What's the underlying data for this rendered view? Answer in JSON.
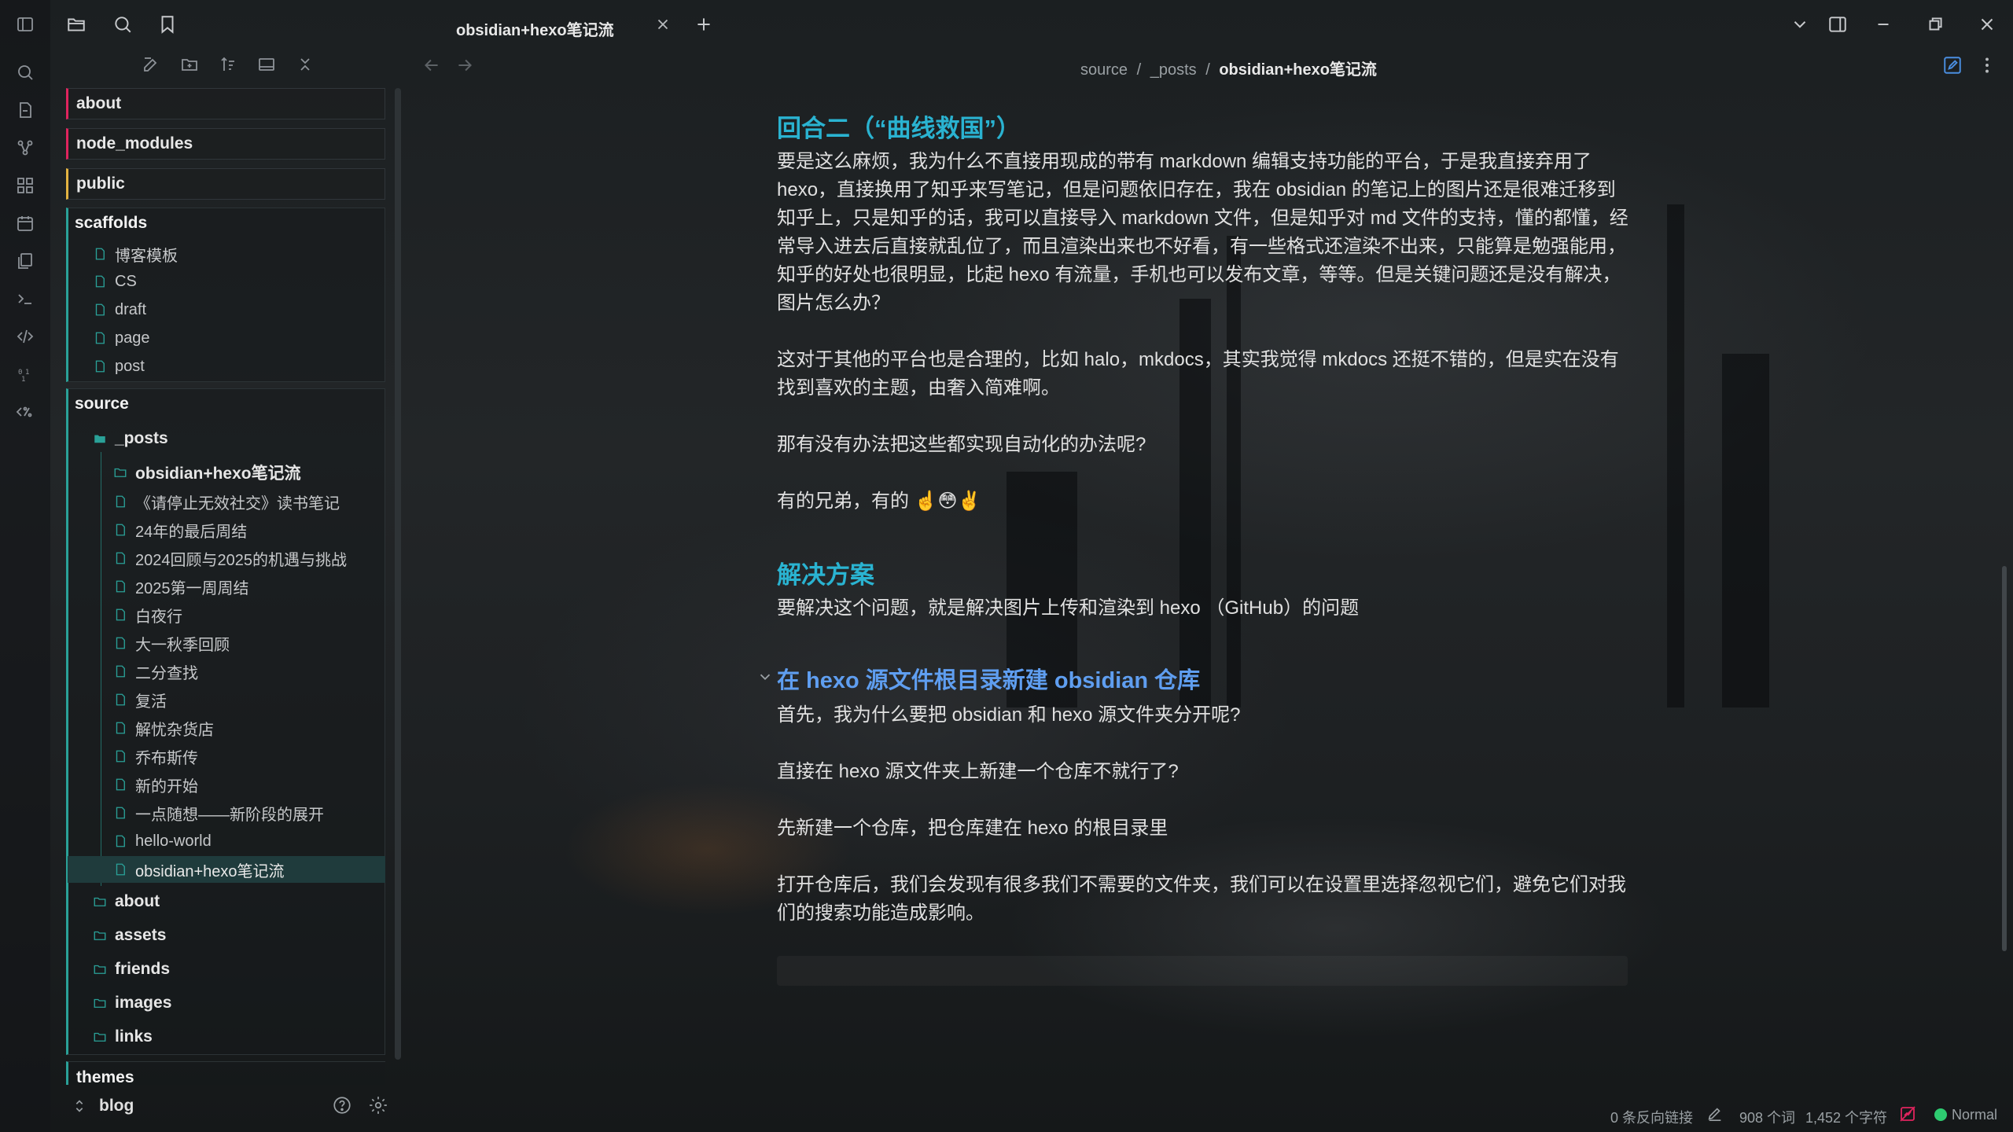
{
  "tab": {
    "title": "obsidian+hexo笔记流"
  },
  "breadcrumb": {
    "part1": "source",
    "sep": "/",
    "part2": "_posts",
    "current": "obsidian+hexo笔记流"
  },
  "explorer": {
    "top_folders": [
      {
        "label": "about",
        "color": "#e0245e"
      },
      {
        "label": "node_modules",
        "color": "#e0245e"
      },
      {
        "label": "public",
        "color": "#e3b341"
      }
    ],
    "scaffolds": {
      "label": "scaffolds",
      "files": [
        "博客模板",
        "CS",
        "draft",
        "page",
        "post"
      ]
    },
    "source": {
      "label": "source",
      "posts_folder": "_posts",
      "posts_subfolder": "obsidian+hexo笔记流",
      "files": [
        "《请停止无效社交》读书笔记",
        "24年的最后周结",
        "2024回顾与2025的机遇与挑战",
        "2025第一周周结",
        "白夜行",
        "大一秋季回顾",
        "二分查找",
        "复活",
        "解忧杂货店",
        "乔布斯传",
        "新的开始",
        "一点随想——新阶段的展开",
        "hello-world",
        "obsidian+hexo笔记流"
      ],
      "folders": [
        "about",
        "assets",
        "friends",
        "images",
        "links"
      ]
    },
    "themes": "themes",
    "vault_name": "blog"
  },
  "doc": {
    "h_round2": "回合二（“曲线救国”）",
    "p1": "要是这么麻烦，我为什么不直接用现成的带有 markdown 编辑支持功能的平台，于是我直接弃用了 hexo，直接换用了知乎来写笔记，但是问题依旧存在，我在 obsidian 的笔记上的图片还是很难迁移到知乎上，只是知乎的话，我可以直接导入 markdown 文件，但是知乎对 md 文件的支持，懂的都懂，经常导入进去后直接就乱位了，而且渲染出来也不好看，有一些格式还渲染不出来，只能算是勉强能用，知乎的好处也很明显，比起 hexo 有流量，手机也可以发布文章，等等。但是关键问题还是没有解决，图片怎么办？",
    "p2": "这对于其他的平台也是合理的，比如 halo，mkdocs，其实我觉得 mkdocs 还挺不错的，但是实在没有找到喜欢的主题，由奢入简难啊。",
    "p3": "那有没有办法把这些都实现自动化的办法呢?",
    "p4": "有的兄弟，有的 ☝️😳✌️",
    "h_solution": "解决方案",
    "p5": "要解决这个问题，就是解决图片上传和渲染到 hexo （GitHub）的问题",
    "h_vault": "在 hexo 源文件根目录新建 obsidian 仓库",
    "p6": "首先，我为什么要把 obsidian 和 hexo 源文件夹分开呢?",
    "p7": "直接在 hexo 源文件夹上新建一个仓库不就行了?",
    "p8": "先新建一个仓库，把仓库建在 hexo 的根目录里",
    "p9": "打开仓库后，我们会发现有很多我们不需要的文件夹，我们可以在设置里选择忽视它们，避免它们对我们的搜索功能造成影响。"
  },
  "status": {
    "backlinks": "0 条反向链接",
    "words": "908 个词",
    "chars": "1,452 个字符",
    "mode": "Normal",
    "mode_color": "#2ecc71"
  },
  "colors": {
    "accent": "#2aa198",
    "heading": "#2ab3d1",
    "heading3": "#5f9ef0"
  }
}
